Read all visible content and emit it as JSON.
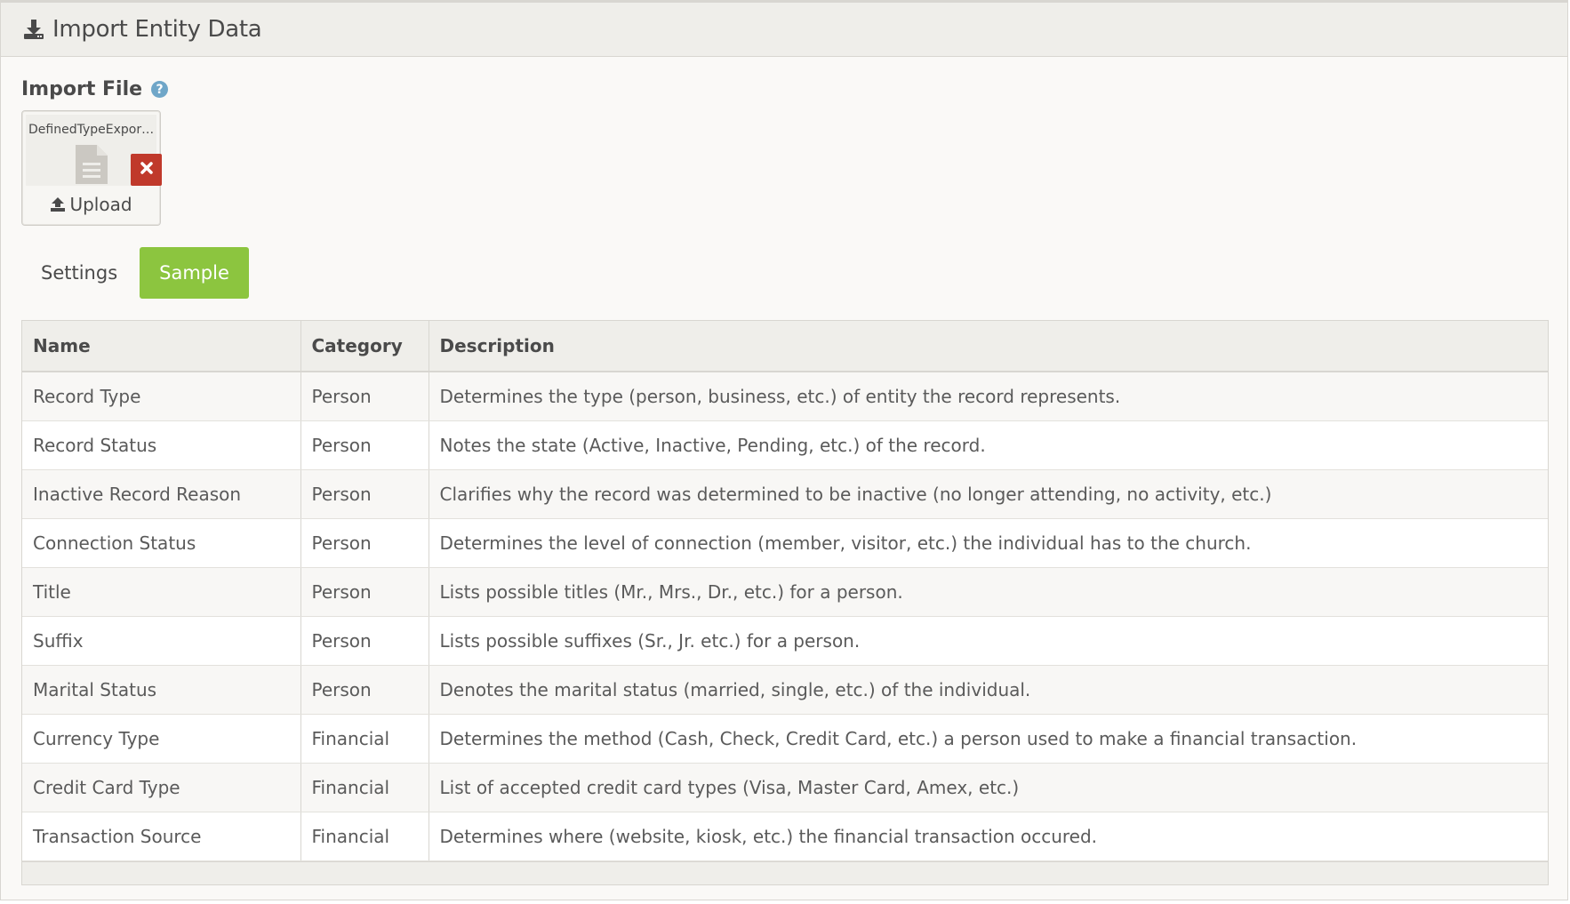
{
  "header": {
    "title": "Import Entity Data",
    "icon": "download-icon"
  },
  "import_file": {
    "label": "Import File",
    "help_icon": "question-circle-icon",
    "file_name": "DefinedTypeExport...",
    "upload_label": "Upload",
    "remove_icon": "times-icon",
    "file_icon": "file-text-icon"
  },
  "tabs": [
    {
      "label": "Settings",
      "active": false
    },
    {
      "label": "Sample",
      "active": true
    }
  ],
  "colors": {
    "accent": "#8cc53f",
    "danger": "#c0392b",
    "help": "#6fa6c8"
  },
  "table": {
    "columns": [
      "Name",
      "Category",
      "Description"
    ],
    "rows": [
      [
        "Record Type",
        "Person",
        "Determines the type (person, business, etc.) of entity the record represents."
      ],
      [
        "Record Status",
        "Person",
        "Notes the state (Active, Inactive, Pending, etc.) of the record."
      ],
      [
        "Inactive Record Reason",
        "Person",
        "Clarifies why the record was determined to be inactive (no longer attending, no activity, etc.)"
      ],
      [
        "Connection Status",
        "Person",
        "Determines the level of connection (member, visitor, etc.) the individual has to the church."
      ],
      [
        "Title",
        "Person",
        "Lists possible titles (Mr., Mrs., Dr., etc.) for a person."
      ],
      [
        "Suffix",
        "Person",
        "Lists possible suffixes (Sr., Jr. etc.) for a person."
      ],
      [
        "Marital Status",
        "Person",
        "Denotes the marital status (married, single, etc.) of the individual."
      ],
      [
        "Currency Type",
        "Financial",
        "Determines the method (Cash, Check, Credit Card, etc.) a person used to make a financial transaction."
      ],
      [
        "Credit Card Type",
        "Financial",
        "List of accepted credit card types (Visa, Master Card, Amex, etc.)"
      ],
      [
        "Transaction Source",
        "Financial",
        "Determines where (website, kiosk, etc.) the financial transaction occured."
      ]
    ]
  }
}
